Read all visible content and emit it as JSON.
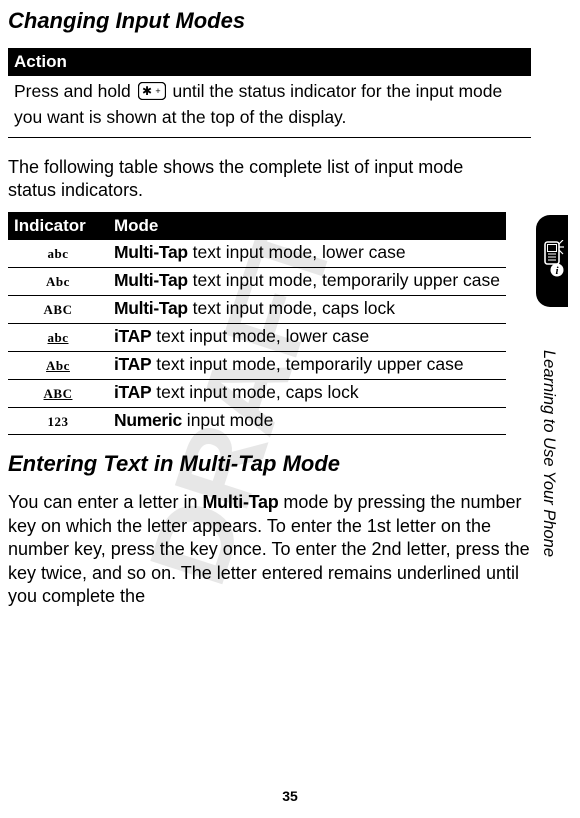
{
  "heading_changing": "Changing Input Modes",
  "action_header": "Action",
  "action_text_before": "Press and hold ",
  "action_text_after": " until the status indicator for the input mode you want is shown at the top of the display.",
  "following_text": "The following table shows the complete list of input mode status indicators.",
  "indicator_header": "Indicator",
  "mode_header": "Mode",
  "rows": [
    {
      "ind": "abc",
      "underline": false,
      "mode_bold": "Multi-Tap",
      "mode_rest": " text input mode, lower case"
    },
    {
      "ind": "Abc",
      "underline": false,
      "mode_bold": "Multi-Tap",
      "mode_rest": " text input mode, temporarily upper case"
    },
    {
      "ind": "ABC",
      "underline": false,
      "mode_bold": "Multi-Tap",
      "mode_rest": " text input mode, caps lock"
    },
    {
      "ind": "abc",
      "underline": true,
      "mode_bold": "iTAP",
      "mode_rest": " text input mode, lower case"
    },
    {
      "ind": "Abc",
      "underline": true,
      "mode_bold": "iTAP",
      "mode_rest": " text input mode, temporarily upper case"
    },
    {
      "ind": "ABC",
      "underline": true,
      "mode_bold": "iTAP",
      "mode_rest": " text input mode, caps lock"
    },
    {
      "ind": "123",
      "underline": false,
      "mode_bold": "Numeric",
      "mode_rest": " input mode"
    }
  ],
  "heading_entering": "Entering Text in Multi-Tap Mode",
  "body_before": "You can enter a letter in ",
  "body_bold": "Multi-Tap",
  "body_after": " mode by pressing the number key on which the letter appears. To enter the 1st letter on the number key, press the key once. To enter the 2nd letter, press the key twice, and so on. The letter entered remains underlined until you complete the",
  "sidebar_text": "Learning to Use Your Phone",
  "page_number": "35",
  "watermark": "DRAFT",
  "icons": {
    "star_key": "star-key-icon",
    "phone_info": "phone-info-icon"
  }
}
